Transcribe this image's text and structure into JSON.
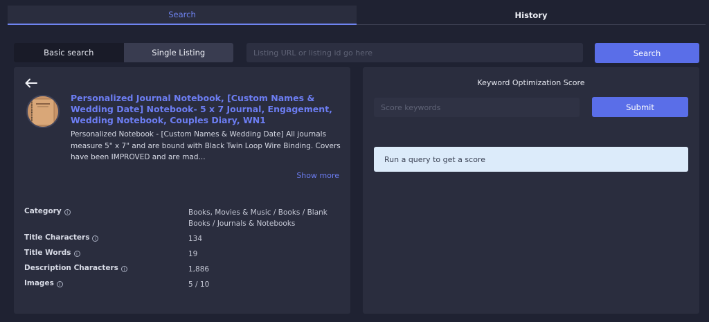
{
  "tabs": {
    "search": "Search",
    "history": "History"
  },
  "search_bar": {
    "basic_label": "Basic search",
    "single_label": "Single Listing",
    "url_placeholder": "Listing URL or listing id go here",
    "search_label": "Search"
  },
  "listing": {
    "title": "Personalized Journal Notebook, [Custom Names & Wedding Date] Notebook- 5 x 7 Journal, Engagement, Wedding Notebook, Couples Diary, WN1",
    "description": "Personalized Notebook - [Custom Names & Wedding Date] All journals measure 5\" x 7\" and are bound with Black Twin Loop Wire Binding. Covers have been IMPROVED and are mad...",
    "show_more": "Show more",
    "stats": [
      {
        "label": "Category",
        "value": "Books, Movies & Music / Books / Blank Books / Journals & Notebooks"
      },
      {
        "label": "Title Characters",
        "value": "134"
      },
      {
        "label": "Title Words",
        "value": "19"
      },
      {
        "label": "Description Characters",
        "value": "1,886"
      },
      {
        "label": "Images",
        "value": "5 / 10"
      }
    ]
  },
  "keyword": {
    "title": "Keyword Optimization Score",
    "placeholder": "Score keywords",
    "submit_label": "Submit",
    "alert": "Run a query to get a score"
  },
  "colors": {
    "accent": "#5a6ee8",
    "link": "#6c7df2",
    "panel": "#2a2d3e",
    "background": "#1f2232",
    "alert_bg": "#dcebfa"
  },
  "icons": [
    "arrow-left-icon",
    "info-icon"
  ]
}
